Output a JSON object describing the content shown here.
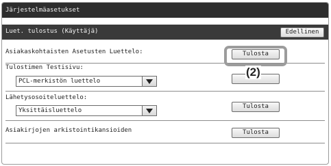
{
  "window": {
    "title": "Järjestelmäasetukset"
  },
  "header": {
    "title": "Luet. tulostus (Käyttäjä)",
    "back_label": "Edellinen"
  },
  "rows": [
    {
      "label": "Asiakaskohtaisten Asetusten Luettelo:",
      "button": "Tulosta"
    },
    {
      "label": "Tulostimen Testisivu:",
      "select_value": "PCL-merkistön luettelo",
      "button": ""
    },
    {
      "label": "Lähetysosoiteluettelo:",
      "select_value": "Yksittäisluettelo",
      "button": "Tulosta"
    },
    {
      "label": "Asiakirjojen arkistointikansioiden",
      "button": "Tulosta"
    }
  ],
  "annotation": {
    "callout": "(2)"
  },
  "icons": {
    "dropdown": "chevron-down-icon"
  },
  "colors": {
    "titlebar": "#2e2e2e",
    "subbar": "#3a3a3a",
    "highlight": "#9c9c9c"
  }
}
